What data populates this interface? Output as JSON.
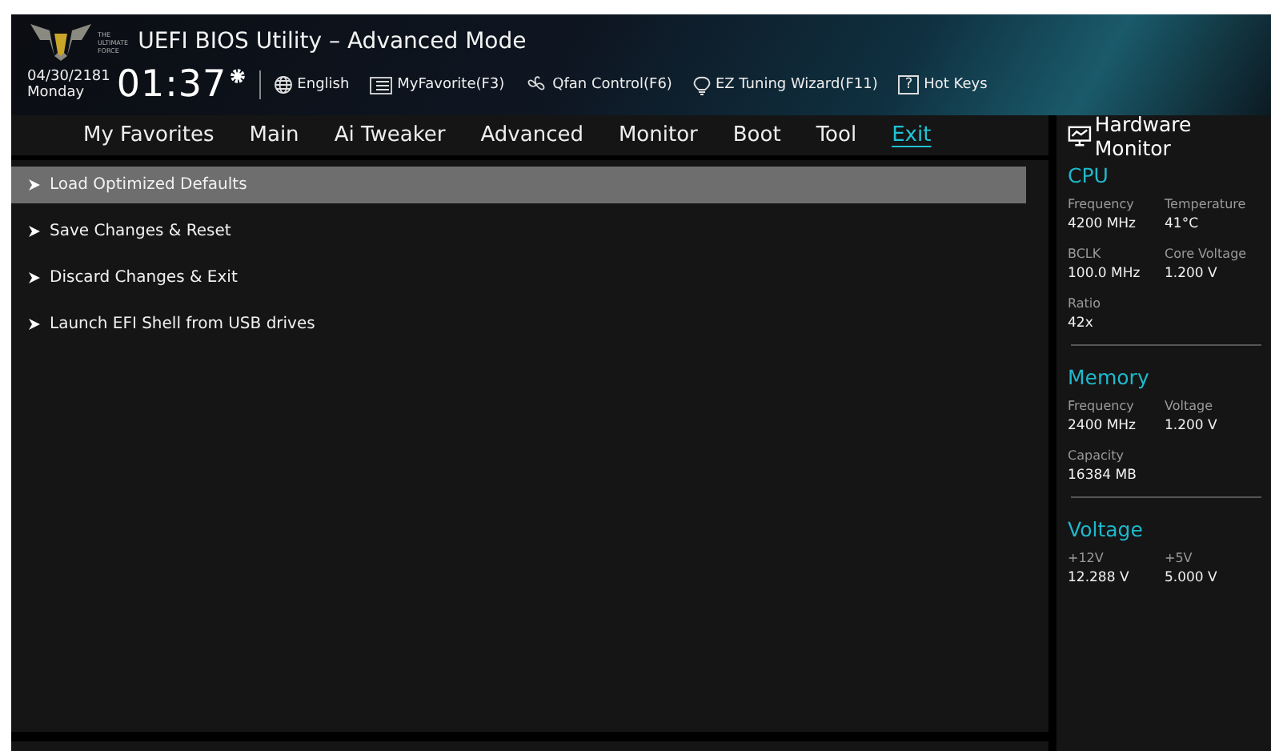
{
  "header": {
    "logo_lines": [
      "THE",
      "ULTIMATE",
      "FORCE"
    ],
    "title": "UEFI BIOS Utility – Advanced Mode",
    "date": "04/30/2181",
    "day": "Monday",
    "time": "01:37",
    "tools": [
      {
        "kind": "globe",
        "label": "English"
      },
      {
        "kind": "list",
        "label": "MyFavorite(F3)"
      },
      {
        "kind": "fan",
        "label": "Qfan Control(F6)"
      },
      {
        "kind": "bulb",
        "label": "EZ Tuning Wizard(F11)"
      },
      {
        "kind": "help",
        "glyph": "?",
        "label": "Hot Keys"
      }
    ]
  },
  "tabs": [
    {
      "label": "My Favorites",
      "selected": false
    },
    {
      "label": "Main",
      "selected": false
    },
    {
      "label": "Ai Tweaker",
      "selected": false
    },
    {
      "label": "Advanced",
      "selected": false
    },
    {
      "label": "Monitor",
      "selected": false
    },
    {
      "label": "Boot",
      "selected": false
    },
    {
      "label": "Tool",
      "selected": false
    },
    {
      "label": "Exit",
      "selected": true
    }
  ],
  "menu_items": [
    {
      "label": "Load Optimized Defaults",
      "selected": true
    },
    {
      "label": "Save Changes & Reset",
      "selected": false
    },
    {
      "label": "Discard Changes & Exit",
      "selected": false
    },
    {
      "label": "Launch EFI Shell from USB drives",
      "selected": false
    }
  ],
  "hardware_monitor": {
    "title": "Hardware Monitor",
    "sections": [
      {
        "title": "CPU",
        "items": [
          {
            "label": "Frequency",
            "value": "4200 MHz"
          },
          {
            "label": "Temperature",
            "value": "41°C"
          },
          {
            "label": "BCLK",
            "value": "100.0 MHz"
          },
          {
            "label": "Core Voltage",
            "value": "1.200 V"
          },
          {
            "label": "Ratio",
            "value": "42x"
          }
        ]
      },
      {
        "title": "Memory",
        "items": [
          {
            "label": "Frequency",
            "value": "2400 MHz"
          },
          {
            "label": "Voltage",
            "value": "1.200 V"
          },
          {
            "label": "Capacity",
            "value": "16384 MB"
          }
        ]
      },
      {
        "title": "Voltage",
        "items": [
          {
            "label": "+12V",
            "value": "12.288 V"
          },
          {
            "label": "+5V",
            "value": "5.000 V"
          }
        ]
      }
    ]
  }
}
